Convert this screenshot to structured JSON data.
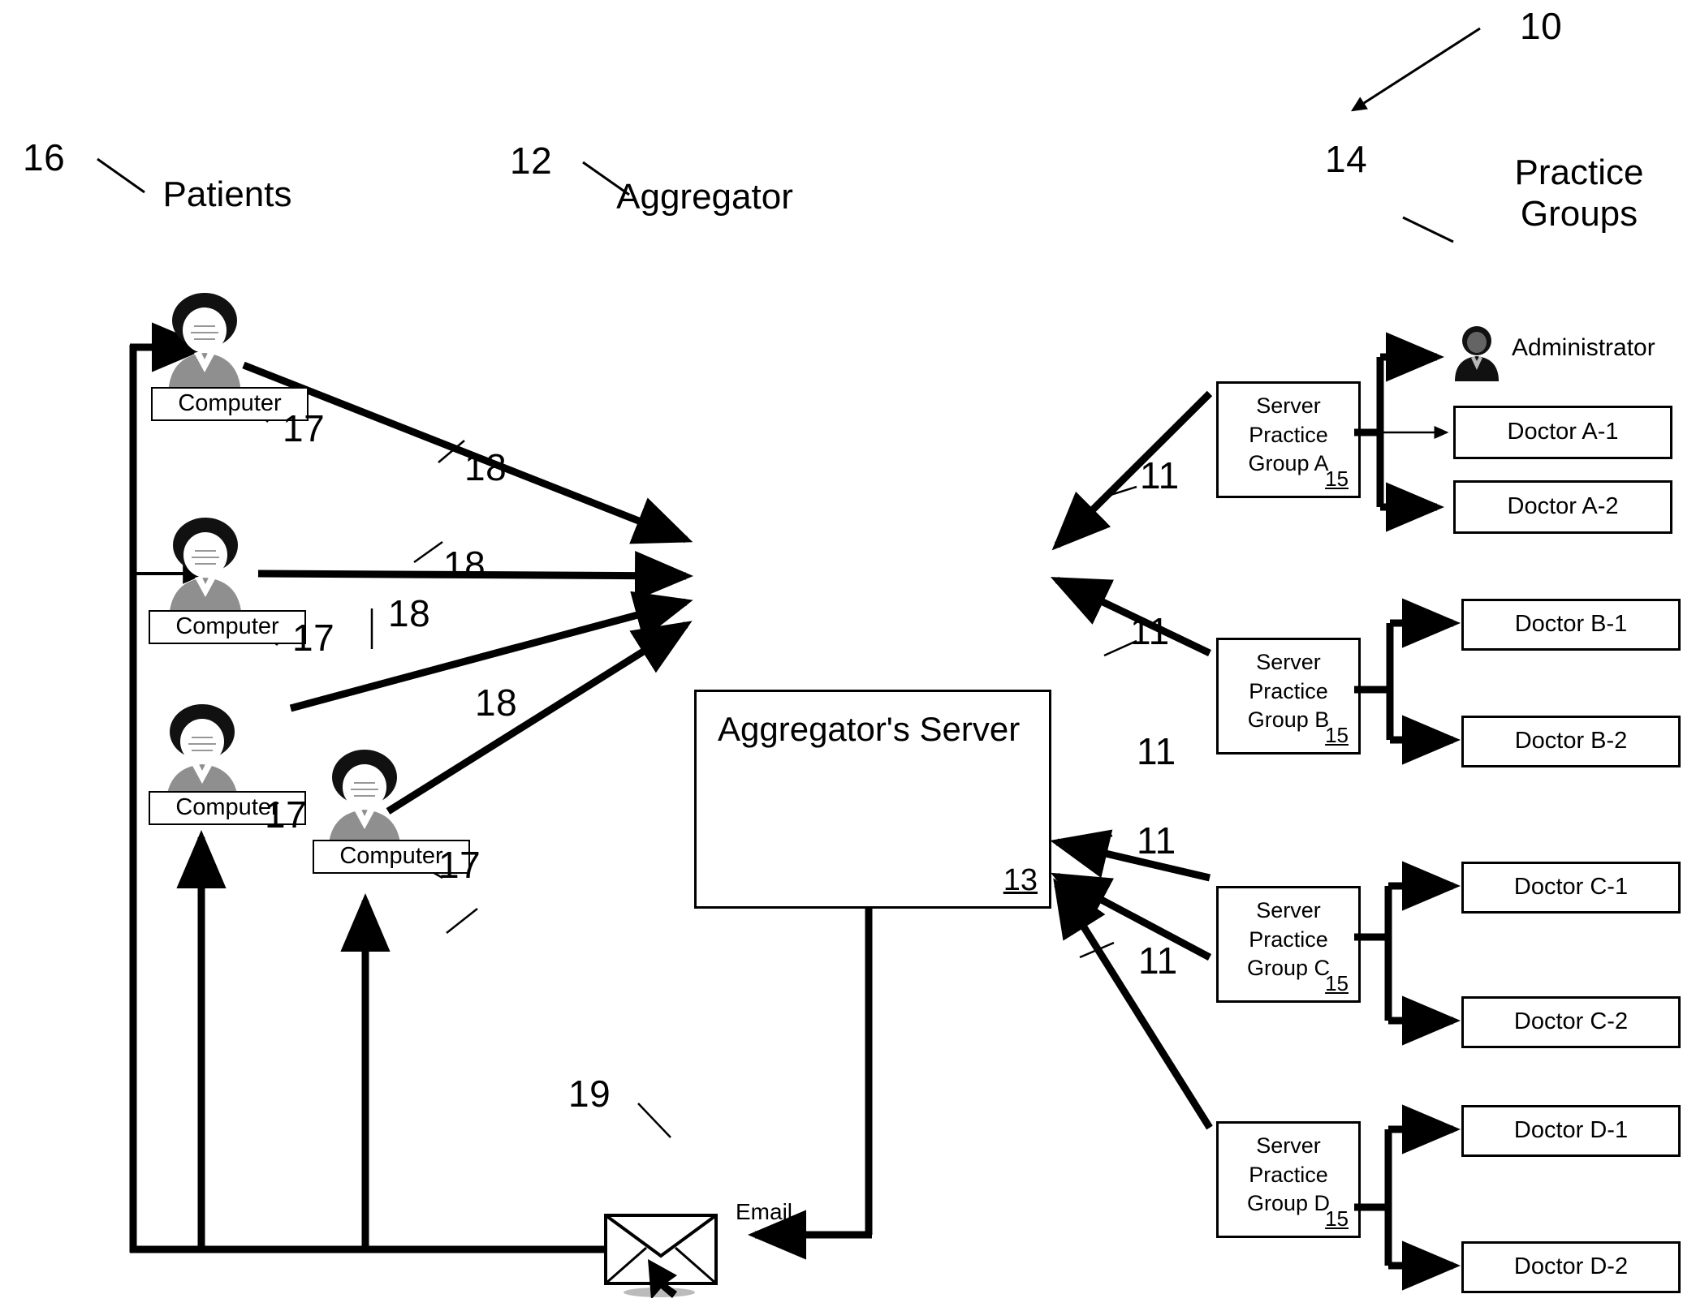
{
  "figure": {
    "ref_overall": "10",
    "ref_patients": "16",
    "ref_aggregator": "12",
    "ref_practice_groups": "14"
  },
  "sections": {
    "patients_title": "Patients",
    "aggregator_title": "Aggregator",
    "practice_groups_title_line1": "Practice",
    "practice_groups_title_line2": "Groups"
  },
  "aggregator": {
    "server_label": "Aggregator's Server",
    "server_ref": "13"
  },
  "patients": [
    {
      "computer_label": "Computer",
      "ref": "17",
      "link_ref": "18"
    },
    {
      "computer_label": "Computer",
      "ref": "17",
      "link_ref": "18"
    },
    {
      "computer_label": "Computer",
      "ref": "17",
      "link_ref": "18"
    },
    {
      "computer_label": "Computer",
      "ref": "17",
      "link_ref": "18"
    }
  ],
  "email": {
    "label": "Email",
    "ref": "19",
    "icon": "envelope-icon",
    "cursor_icon": "mouse-pointer-icon"
  },
  "practice_groups": [
    {
      "server_line1": "Server",
      "server_line2": "Practice",
      "server_line3": "Group A",
      "server_ref": "15",
      "link_ref": "11",
      "administrator": {
        "label": "Administrator",
        "icon": "administrator-icon"
      },
      "doctors": [
        "Doctor A-1",
        "Doctor A-2"
      ]
    },
    {
      "server_line1": "Server",
      "server_line2": "Practice",
      "server_line3": "Group B",
      "server_ref": "15",
      "link_ref": "11",
      "doctors": [
        "Doctor B-1",
        "Doctor B-2"
      ]
    },
    {
      "server_line1": "Server",
      "server_line2": "Practice",
      "server_line3": "Group C",
      "server_ref": "15",
      "link_ref": "11",
      "doctors": [
        "Doctor C-1",
        "Doctor C-2"
      ]
    },
    {
      "server_line1": "Server",
      "server_line2": "Practice",
      "server_line3": "Group D",
      "server_ref": "15",
      "link_ref": "11",
      "doctors": [
        "Doctor D-1",
        "Doctor D-2"
      ]
    }
  ],
  "link_refs": {
    "patient_to_server_1": "18",
    "patient_to_server_2": "18",
    "patient_to_server_3": "18",
    "patient_to_server_4": "18",
    "group_a": "11",
    "group_b_in": "11",
    "group_b_out": "11",
    "group_c_in": "11",
    "group_c_out": "11",
    "email_link": "19"
  },
  "colors": {
    "ink": "#000000",
    "paper": "#ffffff"
  }
}
